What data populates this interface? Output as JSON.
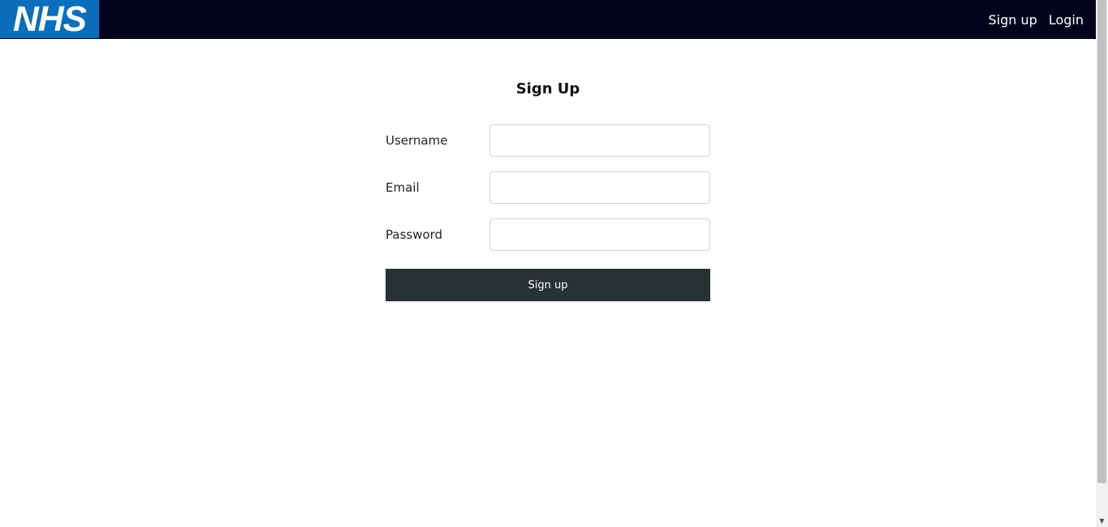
{
  "navbar": {
    "logo_text": "NHS",
    "links": [
      {
        "label": "Sign up"
      },
      {
        "label": "Login"
      }
    ],
    "background": "#02021c",
    "logo_background": "#0a6ebd"
  },
  "form": {
    "title": "Sign Up",
    "fields": [
      {
        "label": "Username",
        "value": "",
        "placeholder": ""
      },
      {
        "label": "Email",
        "value": "",
        "placeholder": ""
      },
      {
        "label": "Password",
        "value": "",
        "placeholder": ""
      }
    ],
    "submit_label": "Sign up",
    "button_color": "#283234"
  },
  "scrollbar": {
    "down_arrow_icon": "chevron-down-icon"
  }
}
